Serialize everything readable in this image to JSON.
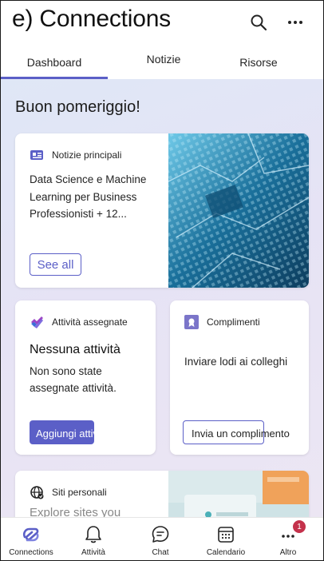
{
  "header": {
    "title": "e) Connections",
    "search_icon": "search-icon",
    "more_icon": "more-horizontal-icon"
  },
  "tabs": [
    {
      "label": "Dashboard",
      "selected": true
    },
    {
      "label": "Notizie",
      "selected": false
    },
    {
      "label": "Risorse",
      "selected": false
    }
  ],
  "greeting": "Buon pomeriggio!",
  "cards": {
    "news": {
      "title": "Notizie principali",
      "icon": "news-icon",
      "text": "Data Science e Machine Learning per Business Professionisti + 12...",
      "button": "See all"
    },
    "tasks": {
      "title": "Attività assegnate",
      "icon": "tasks-icon",
      "heading": "Nessuna attività",
      "description": "Non sono state assegnate attività.",
      "button": "Aggiungi attività"
    },
    "praise": {
      "title": "Complimenti",
      "icon": "medal-icon",
      "description": "Inviare lodi ai colleghi",
      "button": "Invia un complimento"
    },
    "sites": {
      "title": "Siti personali",
      "icon": "globe-icon",
      "text": "Explore sites you"
    }
  },
  "bottom_nav": [
    {
      "label": "Connections",
      "icon": "connections-icon",
      "selected": true
    },
    {
      "label": "Attività",
      "icon": "bell-icon",
      "selected": false
    },
    {
      "label": "Chat",
      "icon": "chat-icon",
      "selected": false
    },
    {
      "label": "Calendario",
      "icon": "calendar-icon",
      "selected": false
    },
    {
      "label": "Altro",
      "icon": "more-horizontal-icon",
      "selected": false,
      "badge": "1"
    }
  ],
  "colors": {
    "accent": "#5b5fc7",
    "badge": "#c4314b"
  }
}
